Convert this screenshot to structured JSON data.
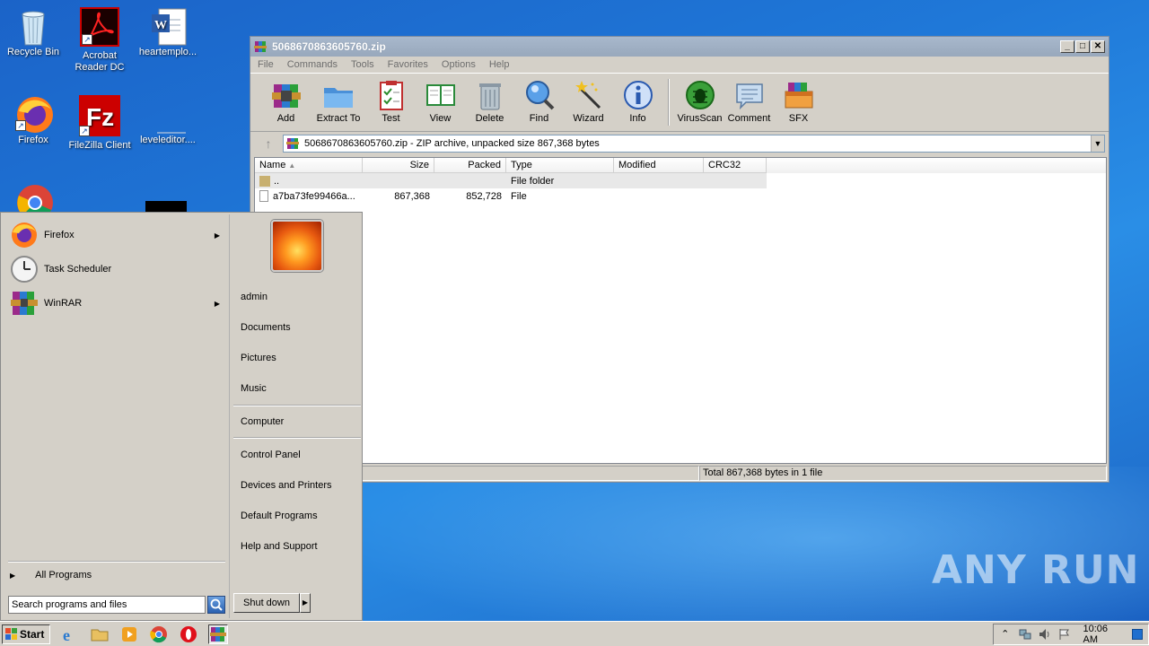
{
  "desktop": {
    "icons": [
      {
        "label": "Recycle Bin"
      },
      {
        "label": "Acrobat Reader DC"
      },
      {
        "label": "heartemplo..."
      },
      {
        "label": "Firefox"
      },
      {
        "label": "FileZilla Client"
      },
      {
        "label": "leveleditor...."
      }
    ],
    "watermark": "ANY  RUN"
  },
  "winrar": {
    "title": "5068670863605760.zip",
    "menu": [
      "File",
      "Commands",
      "Tools",
      "Favorites",
      "Options",
      "Help"
    ],
    "toolbar": [
      "Add",
      "Extract To",
      "Test",
      "View",
      "Delete",
      "Find",
      "Wizard",
      "Info",
      "VirusScan",
      "Comment",
      "SFX"
    ],
    "address": "5068670863605760.zip - ZIP archive, unpacked size 867,368 bytes",
    "columns": [
      "Name",
      "Size",
      "Packed",
      "Type",
      "Modified",
      "CRC32"
    ],
    "rows": [
      {
        "name": "..",
        "size": "",
        "packed": "",
        "type": "File folder"
      },
      {
        "name": "a7ba73fe99466a...",
        "size": "867,368",
        "packed": "852,728",
        "type": "File"
      }
    ],
    "status": "Total 867,368 bytes in 1 file"
  },
  "startmenu": {
    "programs": [
      {
        "label": "Firefox"
      },
      {
        "label": "Task Scheduler"
      },
      {
        "label": "WinRAR"
      }
    ],
    "all_programs": "All Programs",
    "search_placeholder": "Search programs and files",
    "right": [
      "admin",
      "Documents",
      "Pictures",
      "Music",
      "Computer",
      "Control Panel",
      "Devices and Printers",
      "Default Programs",
      "Help and Support"
    ],
    "shutdown": "Shut down"
  },
  "taskbar": {
    "start": "Start",
    "clock": "10:06 AM"
  }
}
